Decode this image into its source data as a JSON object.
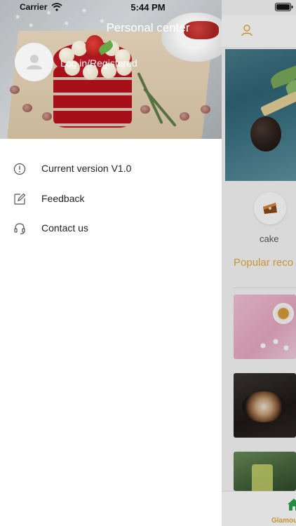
{
  "status_bar": {
    "carrier": "Carrier",
    "time": "5:44 PM"
  },
  "drawer": {
    "title": "Personal center",
    "login_text": "Log in/Registered",
    "menu": [
      {
        "label": "Current version V1.0",
        "icon": "info-circle-icon"
      },
      {
        "label": "Feedback",
        "icon": "edit-icon"
      },
      {
        "label": "Contact us",
        "icon": "headset-icon"
      }
    ]
  },
  "background_app": {
    "category_label": "cake",
    "section_title": "Popular reco",
    "tab_label": "Glamou",
    "accent_color": "#e3ab3a"
  }
}
